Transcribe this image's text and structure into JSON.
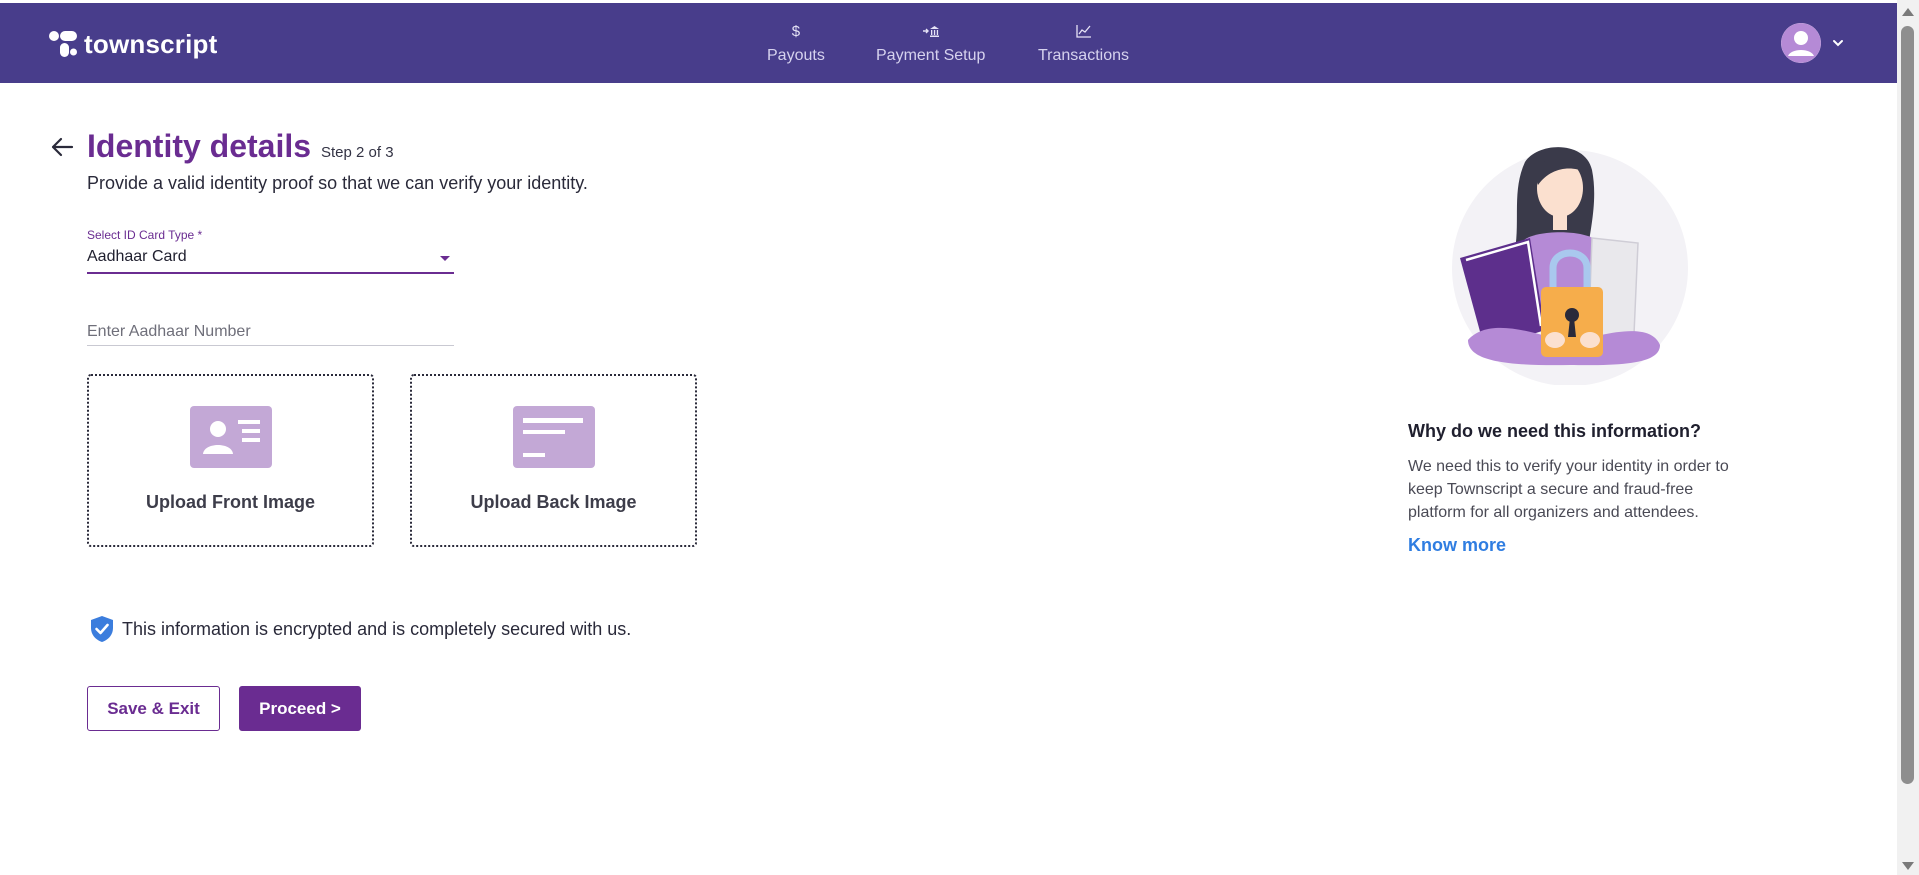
{
  "header": {
    "logo_text": "townscript",
    "nav": [
      {
        "label": "Payouts",
        "icon": "dollar-icon"
      },
      {
        "label": "Payment Setup",
        "icon": "bank-transfer-icon"
      },
      {
        "label": "Transactions",
        "icon": "line-chart-icon"
      }
    ],
    "profile_icon": "user-avatar-icon"
  },
  "page": {
    "title": "Identity details",
    "step": "Step 2 of 3",
    "subtitle": "Provide a valid identity proof so that we can verify your identity."
  },
  "form": {
    "id_type_label": "Select ID Card Type *",
    "id_type_value": "Aadhaar Card",
    "number_placeholder": "Enter Aadhaar Number",
    "number_value": "",
    "upload_front_label": "Upload Front Image",
    "upload_back_label": "Upload Back Image",
    "secure_note": "This information is encrypted and is completely secured with us.",
    "save_label": "Save & Exit",
    "proceed_label": "Proceed >"
  },
  "info": {
    "title": "Why do we need this information?",
    "body": "We need this to verify your identity in order to keep Townscript a secure and fraud-free platform for all organizers and attendees.",
    "link": "Know more"
  },
  "colors": {
    "header_bg": "#483d8b",
    "brand_purple": "#6a2c91",
    "upload_icon": "#c3a8d6",
    "link_blue": "#2f7de1",
    "shield_blue": "#3b7ddd"
  }
}
